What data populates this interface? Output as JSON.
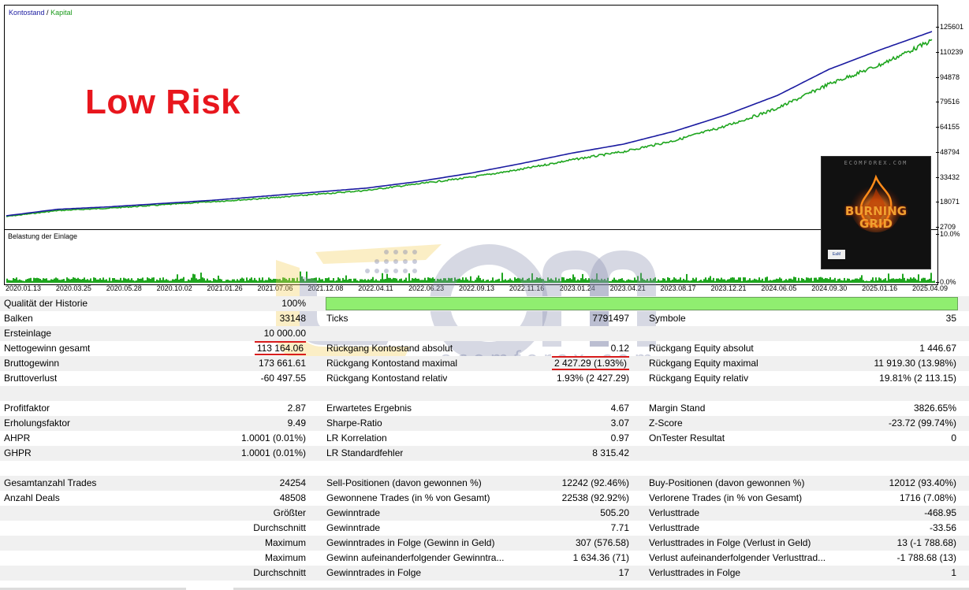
{
  "chart": {
    "legend_balance": "Kontostand",
    "legend_sep": " / ",
    "legend_equity": "Kapital",
    "load_title": "Belastung der Einlage",
    "overlay_text": "Low Risk",
    "colors": {
      "balance": "#1a1aa0",
      "equity": "#1ea51e",
      "highlight": "#e8161d"
    }
  },
  "chart_data": [
    {
      "type": "line",
      "x": [
        "2020.01.13",
        "2020.03.25",
        "2020.05.28",
        "2020.10.02",
        "2021.01.26",
        "2021.07.06",
        "2021.12.08",
        "2022.04.11",
        "2022.06.23",
        "2022.09.13",
        "2022.11.16",
        "2023.01.24",
        "2023.04.21",
        "2023.08.17",
        "2023.12.21",
        "2024.06.05",
        "2024.09.30",
        "2025.01.16",
        "2025.04.09"
      ],
      "series": [
        {
          "name": "Kontostand",
          "values": [
            10000,
            14000,
            15500,
            17500,
            19500,
            22000,
            24500,
            27000,
            31000,
            36000,
            42000,
            48500,
            54000,
            62000,
            72000,
            84000,
            100000,
            112000,
            123164
          ]
        },
        {
          "name": "Kapital",
          "values": [
            9800,
            13500,
            15000,
            17000,
            19000,
            21000,
            23500,
            26000,
            30000,
            34000,
            39000,
            45000,
            50000,
            57000,
            66000,
            77000,
            92000,
            104000,
            119000
          ]
        }
      ],
      "y_ticks": [
        "125601",
        "110239",
        "94878",
        "79516",
        "64155",
        "48794",
        "33432",
        "18071",
        "2709"
      ],
      "ylim": [
        2709,
        125601
      ]
    },
    {
      "type": "area",
      "title": "Belastung der Einlage",
      "y_ticks": [
        "10.0%",
        "0.0%"
      ],
      "ylim": [
        0,
        10
      ]
    }
  ],
  "thumbnail": {
    "site": "ECOMFOREX.COM",
    "title_line1": "BURNING",
    "title_line2": "GRID",
    "badge": "EaM"
  },
  "watermark": {
    "url": "ecomforex.com"
  },
  "report": {
    "quality": {
      "label": "Qualität der Historie",
      "value": "100%"
    },
    "rows": [
      {
        "l1": "Balken",
        "v1": "33148",
        "l2": "Ticks",
        "v2": "7791497",
        "l3": "Symbole",
        "v3": "35"
      },
      {
        "l1": "Ersteinlage",
        "v1": "10 000.00",
        "l2": "",
        "v2": "",
        "l3": "",
        "v3": ""
      },
      {
        "l1": "Nettogewinn gesamt",
        "v1": "113 164.06",
        "l2": "Rückgang Kontostand absolut",
        "v2": "0.12",
        "l3": "Rückgang Equity absolut",
        "v3": "1 446.67"
      },
      {
        "l1": "Bruttogewinn",
        "v1": "173 661.61",
        "l2": "Rückgang Kontostand maximal",
        "v2": "2 427.29 (1.93%)",
        "l3": "Rückgang Equity maximal",
        "v3": "11 919.30 (13.98%)"
      },
      {
        "l1": "Bruttoverlust",
        "v1": "-60 497.55",
        "l2": "Rückgang Kontostand relativ",
        "v2": "1.93% (2 427.29)",
        "l3": "Rückgang Equity relativ",
        "v3": "19.81% (2 113.15)"
      },
      {
        "l1": "",
        "v1": "",
        "l2": "",
        "v2": "",
        "l3": "",
        "v3": ""
      },
      {
        "l1": "Profitfaktor",
        "v1": "2.87",
        "l2": "Erwartetes Ergebnis",
        "v2": "4.67",
        "l3": "Margin Stand",
        "v3": "3826.65%"
      },
      {
        "l1": "Erholungsfaktor",
        "v1": "9.49",
        "l2": "Sharpe-Ratio",
        "v2": "3.07",
        "l3": "Z-Score",
        "v3": "-23.72 (99.74%)"
      },
      {
        "l1": "AHPR",
        "v1": "1.0001 (0.01%)",
        "l2": "LR Korrelation",
        "v2": "0.97",
        "l3": "OnTester Resultat",
        "v3": "0"
      },
      {
        "l1": "GHPR",
        "v1": "1.0001 (0.01%)",
        "l2": "LR Standardfehler",
        "v2": "8 315.42",
        "l3": "",
        "v3": ""
      },
      {
        "l1": "",
        "v1": "",
        "l2": "",
        "v2": "",
        "l3": "",
        "v3": ""
      },
      {
        "l1": "Gesamtanzahl Trades",
        "v1": "24254",
        "l2": "Sell-Positionen (davon gewonnen %)",
        "v2": "12242 (92.46%)",
        "l3": "Buy-Positionen (davon gewonnen %)",
        "v3": "12012 (93.40%)"
      },
      {
        "l1": "Anzahl Deals",
        "v1": "48508",
        "l2": "Gewonnene Trades (in % von Gesamt)",
        "v2": "22538 (92.92%)",
        "l3": "Verlorene Trades (in % von Gesamt)",
        "v3": "1716 (7.08%)"
      },
      {
        "l1": "",
        "r1": "Größter",
        "l2": "Gewinntrade",
        "v2": "505.20",
        "l3": "Verlusttrade",
        "v3": "-468.95"
      },
      {
        "l1": "",
        "r1": "Durchschnitt",
        "l2": "Gewinntrade",
        "v2": "7.71",
        "l3": "Verlusttrade",
        "v3": "-33.56"
      },
      {
        "l1": "",
        "r1": "Maximum",
        "l2": "Gewinntrades in Folge (Gewinn in Geld)",
        "v2": "307 (576.58)",
        "l3": "Verlusttrades in Folge (Verlust in Geld)",
        "v3": "13 (-1 788.68)"
      },
      {
        "l1": "",
        "r1": "Maximum",
        "l2": "Gewinn aufeinanderfolgender Gewinntra...",
        "v2": "1 634.36 (71)",
        "l3": "Verlust aufeinanderfolgender Verlusttrad...",
        "v3": "-1 788.68 (13)"
      },
      {
        "l1": "",
        "r1": "Durchschnitt",
        "l2": "Gewinntrades in Folge",
        "v2": "17",
        "l3": "Verlusttrades in Folge",
        "v3": "1"
      }
    ]
  }
}
